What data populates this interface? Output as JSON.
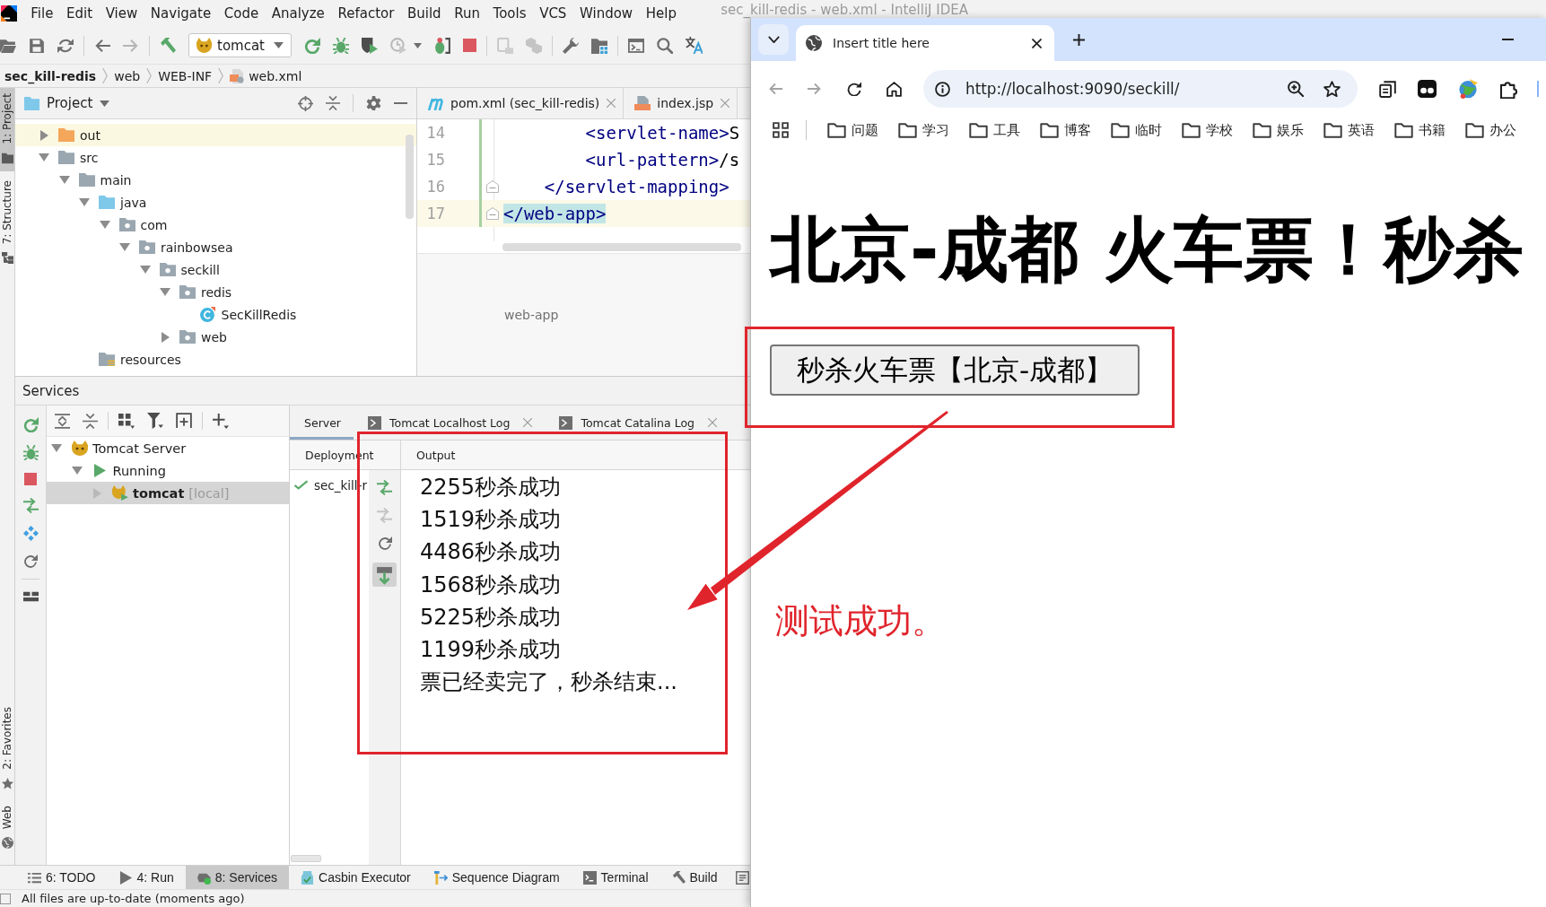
{
  "ide": {
    "title": "sec_kill-redis - web.xml - IntelliJ IDEA",
    "menu": [
      "File",
      "Edit",
      "View",
      "Navigate",
      "Code",
      "Analyze",
      "Refactor",
      "Build",
      "Run",
      "Tools",
      "VCS",
      "Window",
      "Help"
    ],
    "run_config": "tomcat",
    "breadcrumb": [
      {
        "label": "sec_kill-redis",
        "kind": "project"
      },
      {
        "label": "web",
        "kind": "folder"
      },
      {
        "label": "WEB-INF",
        "kind": "folder"
      },
      {
        "label": "web.xml",
        "kind": "xml"
      }
    ],
    "tool_stripe": {
      "top": [
        {
          "label": "1: Project",
          "kind": "project",
          "selected": true
        },
        {
          "label": "7: Structure",
          "kind": "structure",
          "selected": false
        }
      ],
      "bottom": [
        {
          "label": "2: Favorites",
          "kind": "favorites",
          "selected": false
        },
        {
          "label": "Web",
          "kind": "web",
          "selected": false
        }
      ]
    },
    "project": {
      "title": "Project",
      "tree": [
        {
          "label": "out",
          "kind": "excluded",
          "expanded": false
        },
        {
          "label": "src",
          "kind": "folder",
          "expanded": true,
          "children": [
            {
              "label": "main",
              "kind": "folder",
              "expanded": true,
              "children": [
                {
                  "label": "java",
                  "kind": "source",
                  "expanded": true,
                  "children": [
                    {
                      "label": "com",
                      "kind": "package",
                      "expanded": true,
                      "children": [
                        {
                          "label": "rainbowsea",
                          "kind": "package",
                          "expanded": true,
                          "children": [
                            {
                              "label": "seckill",
                              "kind": "package",
                              "expanded": true,
                              "children": [
                                {
                                  "label": "redis",
                                  "kind": "package",
                                  "expanded": true,
                                  "children": [
                                    {
                                      "label": "SecKillRedis",
                                      "kind": "class"
                                    }
                                  ]
                                },
                                {
                                  "label": "web",
                                  "kind": "package",
                                  "expanded": false
                                }
                              ]
                            }
                          ]
                        }
                      ]
                    }
                  ]
                },
                {
                  "label": "resources",
                  "kind": "resources"
                }
              ]
            }
          ]
        }
      ]
    },
    "editor": {
      "tabs": [
        {
          "label": "pom.xml (sec_kill-redis)",
          "kind": "maven",
          "selected": false
        },
        {
          "label": "index.jsp",
          "kind": "jsp",
          "selected": false
        }
      ],
      "lines": [
        {
          "number": "14",
          "code": "        <servlet-name>S",
          "changed": true,
          "fold": false,
          "current": false,
          "matched": false
        },
        {
          "number": "15",
          "code": "        <url-pattern>/s",
          "changed": true,
          "fold": false,
          "current": false,
          "matched": false
        },
        {
          "number": "16",
          "code": "    </servlet-mapping>",
          "changed": true,
          "fold": true,
          "current": false,
          "matched": false
        },
        {
          "number": "17",
          "code": "</web-app>",
          "changed": true,
          "fold": true,
          "current": true,
          "matched": true
        }
      ],
      "breadcrumb": "web-app"
    },
    "services": {
      "title": "Services",
      "tree": [
        {
          "label": "Tomcat Server",
          "kind": "server",
          "expanded": true,
          "selected": false,
          "children": [
            {
              "label": "Running",
              "kind": "running",
              "expanded": true,
              "selected": false,
              "children": [
                {
                  "label": "tomcat",
                  "note": "[local]",
                  "kind": "config",
                  "expanded": false,
                  "selected": true
                }
              ]
            }
          ]
        }
      ],
      "tabs": [
        {
          "label": "Server",
          "kind": "server",
          "selected": true
        },
        {
          "label": "Tomcat Localhost Log",
          "kind": "log",
          "selected": false
        },
        {
          "label": "Tomcat Catalina Log",
          "kind": "log",
          "selected": false
        }
      ],
      "deployment_header": "Deployment",
      "deployments": [
        "sec_kill-r"
      ],
      "output_header": "Output",
      "output": [
        "2255秒杀成功",
        "1519秒杀成功",
        "4486秒杀成功",
        "1568秒杀成功",
        "5225秒杀成功",
        "1199秒杀成功",
        "票已经卖完了，秒杀结束..."
      ]
    },
    "tool_windows": [
      {
        "label": "6: TODO",
        "kind": "todo",
        "selected": false
      },
      {
        "label": "4: Run",
        "kind": "run",
        "selected": false
      },
      {
        "label": "8: Services",
        "kind": "services",
        "selected": true
      },
      {
        "label": "Casbin Executor",
        "kind": "casbin",
        "selected": false
      },
      {
        "label": "Sequence Diagram",
        "kind": "sequence",
        "selected": false
      },
      {
        "label": "Terminal",
        "kind": "terminal",
        "selected": false
      },
      {
        "label": "Build",
        "kind": "build",
        "selected": false
      }
    ],
    "status": "All files are up-to-date (moments ago)"
  },
  "browser": {
    "tab_title": "Insert title here",
    "url": "http://localhost:9090/seckill/",
    "bookmarks": [
      "问题",
      "学习",
      "工具",
      "博客",
      "临时",
      "学校",
      "娱乐",
      "英语",
      "书籍",
      "办公"
    ],
    "heading": "北京-成都 火车票！秒杀",
    "button": "秒杀火车票【北京-成都】"
  },
  "annotation": {
    "note": "测试成功。"
  }
}
